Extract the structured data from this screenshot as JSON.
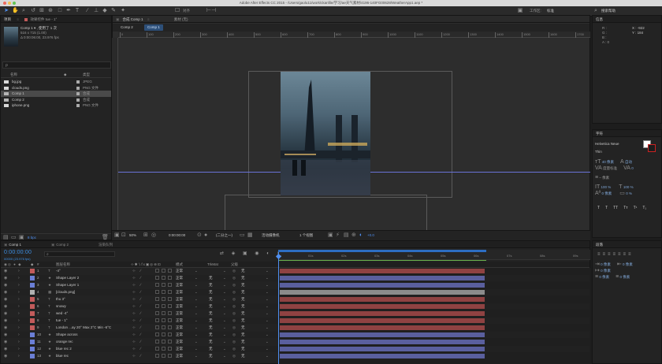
{
  "window": {
    "title": "Adobe After Effects CC 2015 - /Users/gaolu11/work/ckanfile/学习/ae天气素材/4196-140FG00628/WeatherApp1.aep *"
  },
  "toolbar": {
    "snap_label": "对齐",
    "workspace_label": "工作区:",
    "workspace_value": "标准",
    "search_help": "搜索帮助"
  },
  "project": {
    "tab_project": "项目",
    "tab_effects": "效果控件 tue - 1°",
    "selected_name": "Comp 1 ▾ , 使用了 1 次",
    "selected_dims": "516 x 715 (1.00)",
    "selected_duration": "Δ 0:00:06:00, 23.976 fps",
    "search_placeholder": "ρ",
    "col_name": "名称",
    "col_type": "类型",
    "items": [
      {
        "name": "bg.jpg",
        "type": "JPEG",
        "color": "#d7d7d7"
      },
      {
        "name": "clouds.png",
        "type": "PNG 文件",
        "color": "#d7d7d7"
      },
      {
        "name": "Comp 1",
        "type": "合成",
        "color": "#b5b5b5"
      },
      {
        "name": "Comp 2",
        "type": "合成",
        "color": "#b5b5b5"
      },
      {
        "name": "iphone.png",
        "type": "PNG 文件",
        "color": "#d7d7d7"
      }
    ],
    "bpc": "8 bpc"
  },
  "viewer": {
    "comp_tab": "合成 Comp 1",
    "footage_tab": "素材 (无)",
    "breadcrumb_1": "Comp 2",
    "breadcrumb_2": "Comp 1",
    "ruler_ticks": [
      "0",
      "100",
      "200",
      "300",
      "400",
      "500",
      "600",
      "700",
      "800",
      "900",
      "1000",
      "1100",
      "1200",
      "1300",
      "1400",
      "1500",
      "1600",
      "1700"
    ],
    "zoom": "50%",
    "timecode": "0:00:00:00",
    "resolution": "(二分之一)",
    "camera": "活动摄像机",
    "views": "1 个视图",
    "exposure": "+0.0"
  },
  "info": {
    "title": "信息",
    "r": "R :",
    "g": "G :",
    "b": "B :",
    "a": "A : 0",
    "x": "X : -922",
    "y": "Y : 184"
  },
  "character": {
    "title": "字符",
    "font": "Helvetica Neue",
    "style": "Thin",
    "size": "40 像素",
    "leading": "自动",
    "kerning": "度量标准",
    "tracking": "0",
    "stroke": "– 像素",
    "vscale": "100 %",
    "hscale": "100 %",
    "baseline": "0 像素",
    "tsume": "0 %",
    "styles": [
      "T",
      "T",
      "TT",
      "Tт",
      "T¹",
      "T₁"
    ]
  },
  "paragraph": {
    "title": "段落",
    "v1": "0 像素",
    "v2": "0 像素",
    "v3": "0 像素",
    "v4": "0 像素",
    "v5": "0 像素"
  },
  "timeline": {
    "tabs": [
      "Comp 1",
      "Comp 2",
      "渲染队列"
    ],
    "timecode": "0:00:00:00",
    "frame_info": "00000 (23.976 fps)",
    "col_layer": "图层名称",
    "col_mode": "模式",
    "col_trkmat": "TrkMat",
    "col_parent": "父级",
    "time_ticks": [
      "0s",
      "01s",
      "02s",
      "03s",
      "04s",
      "05s",
      "06s",
      "07s",
      "08s",
      "09s"
    ],
    "layers": [
      {
        "n": "1",
        "name": "-4°",
        "type": "T",
        "color": "#c25b5b",
        "mode": "正常",
        "trk": "",
        "parent": "无",
        "bar": "#8f4242"
      },
      {
        "n": "2",
        "name": "Shape Layer 2",
        "type": "★",
        "color": "#6b7fd6",
        "mode": "正常",
        "trk": "无",
        "parent": "无",
        "bar": "#5a5f9e"
      },
      {
        "n": "3",
        "name": "Shape Layer 1",
        "type": "★",
        "color": "#6b7fd6",
        "mode": "正常",
        "trk": "无",
        "parent": "无",
        "bar": "#5a5f9e"
      },
      {
        "n": "4",
        "name": "[clouds.png]",
        "type": "▦",
        "color": "#b0b0b0",
        "mode": "正常",
        "trk": "无",
        "parent": "无",
        "bar": "#8b8b8b"
      },
      {
        "n": "5",
        "name": "thu 3°",
        "type": "T",
        "color": "#c25b5b",
        "mode": "正常",
        "trk": "无",
        "parent": "无",
        "bar": "#8f4242"
      },
      {
        "n": "6",
        "name": "snowy",
        "type": "T",
        "color": "#c25b5b",
        "mode": "正常",
        "trk": "无",
        "parent": "无",
        "bar": "#8f4242"
      },
      {
        "n": "7",
        "name": "wed -4°",
        "type": "T",
        "color": "#c25b5b",
        "mode": "正常",
        "trk": "无",
        "parent": "无",
        "bar": "#8f4242"
      },
      {
        "n": "8",
        "name": "tue - 1°",
        "type": "T",
        "color": "#c25b5b",
        "mode": "正常",
        "trk": "无",
        "parent": "无",
        "bar": "#8f4242"
      },
      {
        "n": "9",
        "name": "London ...ay 20° Max 2°C Min -6°C",
        "type": "T",
        "color": "#c25b5b",
        "mode": "正常",
        "trk": "无",
        "parent": "无",
        "bar": "#8f4242"
      },
      {
        "n": "10",
        "name": "Shape across",
        "type": "★",
        "color": "#6b7fd6",
        "mode": "正常",
        "trk": "无",
        "parent": "无",
        "bar": "#5a5f9e"
      },
      {
        "n": "11",
        "name": "orange rec",
        "type": "★",
        "color": "#6b7fd6",
        "mode": "正常",
        "trk": "无",
        "parent": "无",
        "bar": "#5a5f9e"
      },
      {
        "n": "12",
        "name": "blue rec 2",
        "type": "★",
        "color": "#6b7fd6",
        "mode": "正常",
        "trk": "无",
        "parent": "无",
        "bar": "#5a5f9e"
      },
      {
        "n": "13",
        "name": "blue rec",
        "type": "★",
        "color": "#6b7fd6",
        "mode": "正常",
        "trk": "无",
        "parent": "无",
        "bar": "#5a5f9e"
      }
    ]
  },
  "colors": {
    "accent": "#4f8ff0",
    "timecode": "#3d8fe3",
    "work_area": "#2d6ec2"
  }
}
